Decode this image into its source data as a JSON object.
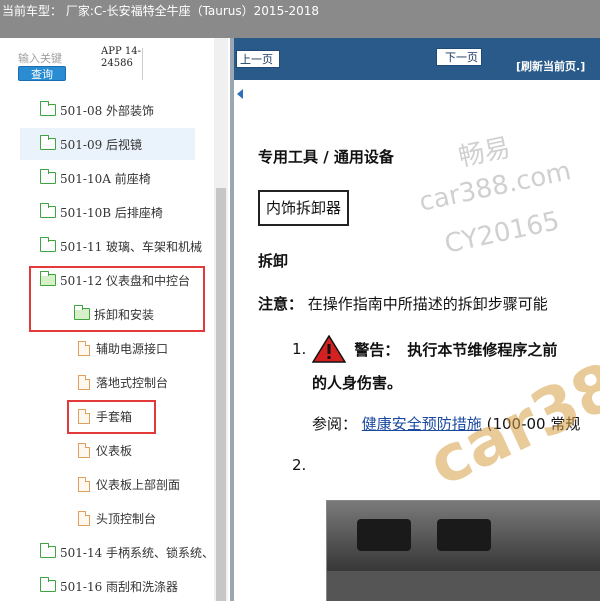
{
  "title_bar": {
    "text": "当前车型： 厂家:C-长安福特全牛座（Taurus）2015-2018"
  },
  "search": {
    "label": "输入关键",
    "button_label": "查询",
    "app_code": "APP 14-24586"
  },
  "tree": {
    "items": [
      {
        "label": "501-08 外部装饰",
        "kind": "folder"
      },
      {
        "label": "501-09 后视镜",
        "kind": "folder"
      },
      {
        "label": "501-10A 前座椅",
        "kind": "folder"
      },
      {
        "label": "501-10B 后排座椅",
        "kind": "folder"
      },
      {
        "label": "501-11 玻璃、车架和机械",
        "kind": "folder"
      },
      {
        "label": "501-12 仪表盘和中控台",
        "kind": "folder-open"
      },
      {
        "label": "拆卸和安装",
        "kind": "folder-open"
      },
      {
        "label": "辅助电源接口",
        "kind": "doc"
      },
      {
        "label": "落地式控制台",
        "kind": "doc"
      },
      {
        "label": "手套箱",
        "kind": "doc"
      },
      {
        "label": "仪表板",
        "kind": "doc"
      },
      {
        "label": "仪表板上部剖面",
        "kind": "doc"
      },
      {
        "label": "头顶控制台",
        "kind": "doc"
      },
      {
        "label": "501-14 手柄系统、锁系统、",
        "kind": "folder"
      },
      {
        "label": "501-16 雨刮和洗涤器",
        "kind": "folder"
      }
    ]
  },
  "toolbar": {
    "prev_label": "上一页",
    "next_label": "下一页",
    "refresh_label": "[刷新当前页.]"
  },
  "content": {
    "heading_tools": "专用工具 / 通用设备",
    "tool_name": "内饰拆卸器",
    "heading_removal": "拆卸",
    "note_label": "注意：",
    "note_text": "在操作指南中所描述的拆卸步骤可能",
    "step1_number": "1.",
    "warning_label": "警告：",
    "warning_text": "执行本节维修程序之前",
    "warning_line2": "的人身伤害。",
    "ref_prefix": "参阅：",
    "ref_link": "健康安全预防措施",
    "ref_suffix": "(100-00 常规",
    "step2_number": "2."
  },
  "watermark": {
    "line1": "畅易",
    "line2": "car388.com",
    "line3": "CY20165",
    "big": "car38"
  },
  "colors": {
    "title_bar": "#8a8a8a",
    "toolbar": "#2a5a8a",
    "search_button": "#2a8dd4",
    "highlight_box": "#e23a3a",
    "folder": "#3fa33f",
    "document": "#e0a060",
    "warning_triangle": "#d32020"
  }
}
